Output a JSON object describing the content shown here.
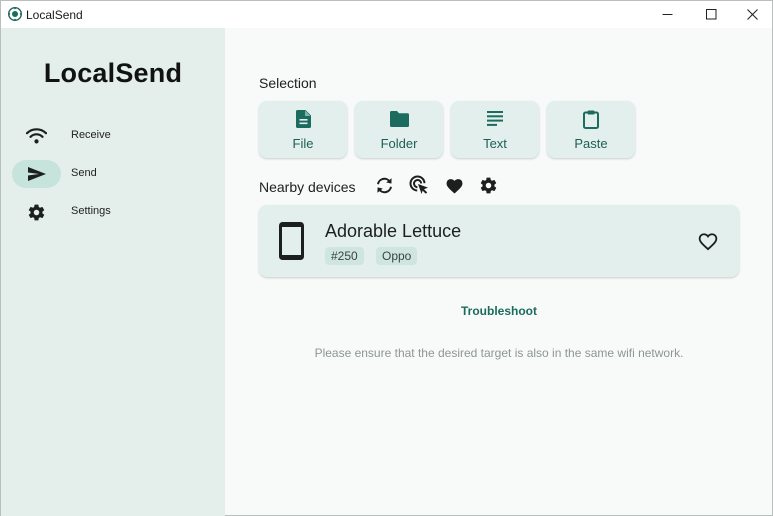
{
  "window": {
    "title": "LocalSend",
    "controls": {
      "minimize_icon": "minimize-icon",
      "maximize_icon": "maximize-icon",
      "close_icon": "close-icon"
    }
  },
  "sidebar": {
    "brand": "LocalSend",
    "items": [
      {
        "label": "Receive",
        "icon": "wifi-icon",
        "active": false
      },
      {
        "label": "Send",
        "icon": "send-icon",
        "active": true
      },
      {
        "label": "Settings",
        "icon": "gear-icon",
        "active": false
      }
    ]
  },
  "selection": {
    "title": "Selection",
    "buttons": [
      {
        "label": "File",
        "icon": "file-icon"
      },
      {
        "label": "Folder",
        "icon": "folder-icon"
      },
      {
        "label": "Text",
        "icon": "text-icon"
      },
      {
        "label": "Paste",
        "icon": "clipboard-icon"
      }
    ]
  },
  "nearby": {
    "title": "Nearby devices",
    "tools": [
      "refresh-icon",
      "scan-target-icon",
      "favorites-icon",
      "settings-icon"
    ],
    "devices": [
      {
        "name": "Adorable Lettuce",
        "tags": [
          "#250",
          "Oppo"
        ],
        "icon": "smartphone-icon",
        "favorite_icon": "heart-outline-icon"
      }
    ]
  },
  "troubleshoot_label": "Troubleshoot",
  "hint": "Please ensure that the desired target is also in the same wifi network.",
  "colors": {
    "accent": "#1c6b5f",
    "sidebar_bg": "#e4efec",
    "active_pill": "#c6e3dc",
    "card_bg": "#e3efec",
    "page_bg": "#f7faf9"
  }
}
